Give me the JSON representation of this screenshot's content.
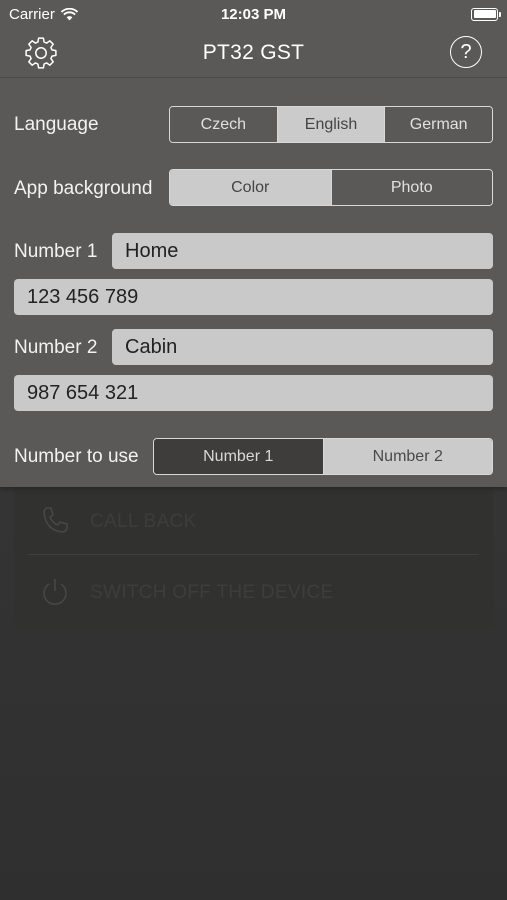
{
  "status_bar": {
    "carrier": "Carrier",
    "time": "12:03 PM"
  },
  "nav": {
    "title": "PT32 GST",
    "help_symbol": "?",
    "left_icon": "gear-icon",
    "right_icon": "help-icon"
  },
  "settings": {
    "language": {
      "label": "Language",
      "options": [
        "Czech",
        "English",
        "German"
      ],
      "selected": "English"
    },
    "app_background": {
      "label": "App background",
      "options": [
        "Color",
        "Photo"
      ],
      "selected": "Color"
    },
    "number1": {
      "label": "Number 1",
      "name_value": "Home",
      "phone_value": "123 456 789"
    },
    "number2": {
      "label": "Number 2",
      "name_value": "Cabin",
      "phone_value": "987 654 321"
    },
    "number_to_use": {
      "label": "Number to use",
      "options": [
        "Number 1",
        "Number 2"
      ],
      "selected": "Number 2"
    }
  },
  "actions": [
    {
      "label": "CALL BACK",
      "icon": "phone-icon"
    },
    {
      "label": "SWITCH OFF THE DEVICE",
      "icon": "power-icon"
    }
  ],
  "colors": {
    "panel_bg": "#5a5957",
    "field_bg": "#c9c9c9",
    "segment_selected": "#cbcbcb",
    "background": "#343434"
  }
}
